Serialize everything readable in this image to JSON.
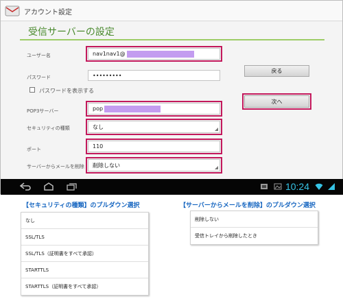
{
  "app_bar": {
    "title": "アカウント設定"
  },
  "page_title": "受信サーバーの設定",
  "form": {
    "username_label": "ユーザー名",
    "username_value": "nav1nav1@",
    "password_label": "パスワード",
    "password_value": "•••••••••",
    "show_password_label": "パスワードを表示する",
    "pop3_label": "POP3サーバー",
    "pop3_value": "pop",
    "security_label": "セキュリティの種類",
    "security_value": "なし",
    "port_label": "ポート",
    "port_value": "110",
    "delete_label": "サーバーからメールを削除",
    "delete_value": "削除しない"
  },
  "buttons": {
    "back": "戻る",
    "next": "次へ"
  },
  "status_bar": {
    "time": "10:24"
  },
  "colors": {
    "title_green": "#4a8a2e",
    "highlight": "#c2185b",
    "mask": "#c39cf0",
    "clock": "#36c4e6",
    "heading_blue": "#1565c0"
  },
  "security_dropdown": {
    "heading": "【セキュリティの種類】のプルダウン選択",
    "options": [
      "なし",
      "SSL/TLS",
      "SSL/TLS（証明書をすべて承認）",
      "STARTTLS",
      "STARTTLS（証明書をすべて承認）"
    ]
  },
  "delete_dropdown": {
    "heading": "【サーバーからメールを削除】のプルダウン選択",
    "options": [
      "削除しない",
      "受信トレイから削除したとき"
    ]
  }
}
